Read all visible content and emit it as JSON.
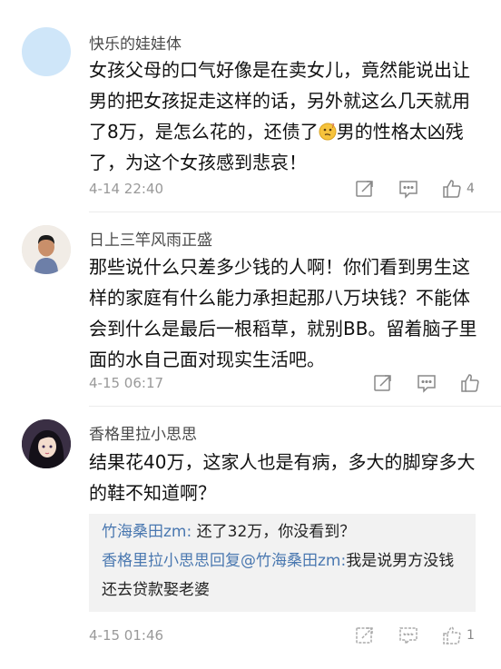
{
  "comments": [
    {
      "username": "快乐的娃娃体",
      "text_before_emoji": "女孩父母的口气好像是在卖女儿，竟然能说出让男的把女孩捉走这样的话，另外就这么几天就用了8万，是怎么花的，还债了",
      "text_after_emoji": "男的性格太凶残了，为这个女孩感到悲哀！",
      "emoji": "thinking-face-emoji",
      "time": "4-14 22:40",
      "likes": "4"
    },
    {
      "username": "日上三竿风雨正盛",
      "text": "那些说什么只差多少钱的人啊！你们看到男生这样的家庭有什么能力承担起那八万块钱？不能体会到什么是最后一根稻草，就别BB。留着脑子里面的水自己面对现实生活吧。",
      "time": "4-15 06:17",
      "likes": ""
    },
    {
      "username": "香格里拉小思思",
      "text": "结果花40万，这家人也是有病，多大的脚穿多大的鞋不知道啊？",
      "replies": [
        {
          "name": "竹海桑田zm:",
          "text": " 还了32万，你没看到？"
        },
        {
          "name": "香格里拉小思思回复@竹海桑田zm:",
          "text": "我是说男方没钱还去贷款娶老婆"
        }
      ],
      "time": "4-15 01:46",
      "likes": "1"
    }
  ],
  "icons": [
    "share-icon",
    "comment-icon",
    "like-icon"
  ],
  "colors": {
    "username": "#4a4a4a",
    "reply_name": "#4a78b0",
    "meta": "#999999",
    "reply_bg": "#f2f2f2"
  }
}
